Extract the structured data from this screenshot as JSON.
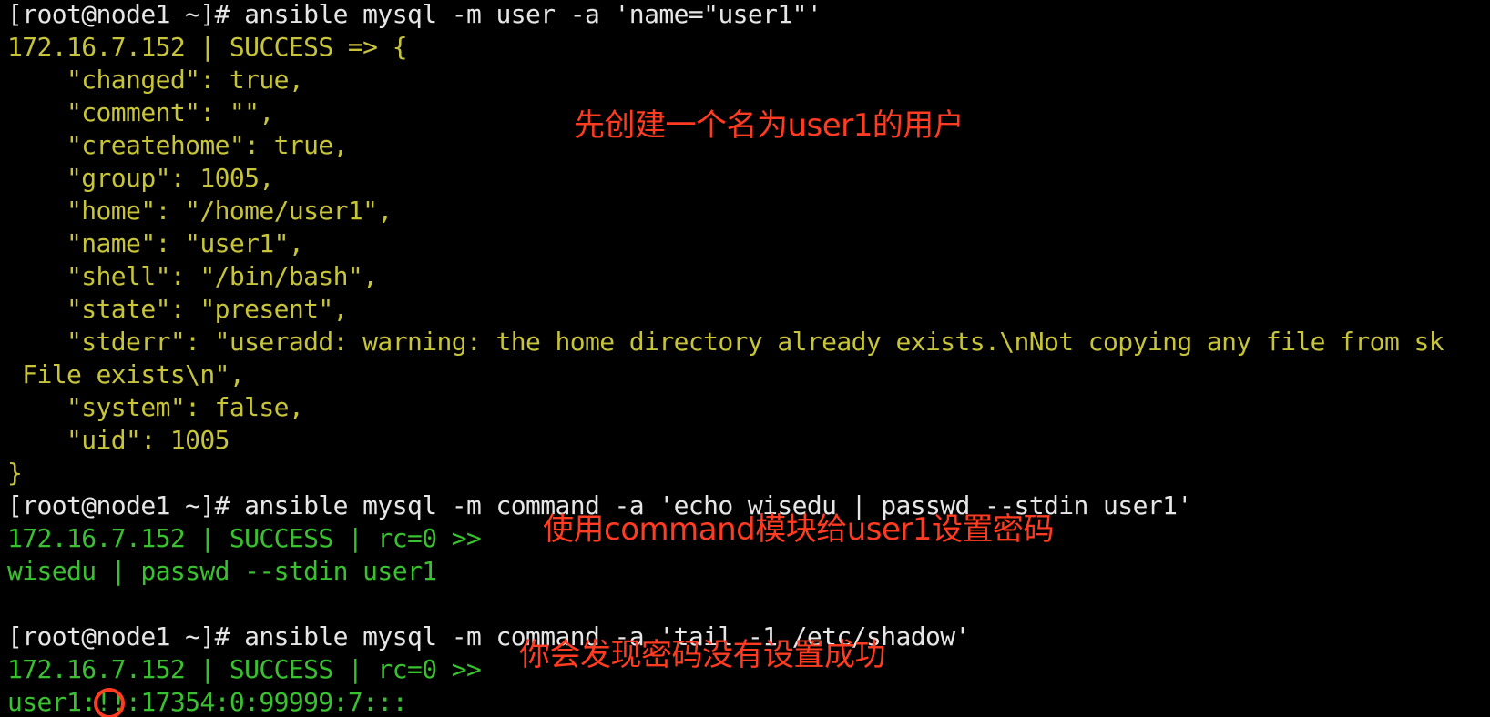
{
  "terminal": {
    "lines": [
      {
        "text": "[root@node1 ~]# ansible mysql -m user -a 'name=\"user1\"'",
        "color": "white"
      },
      {
        "text": "172.16.7.152 | SUCCESS => {",
        "color": "olive"
      },
      {
        "text": "    \"changed\": true,",
        "color": "olive"
      },
      {
        "text": "    \"comment\": \"\",",
        "color": "olive"
      },
      {
        "text": "    \"createhome\": true,",
        "color": "olive"
      },
      {
        "text": "    \"group\": 1005,",
        "color": "olive"
      },
      {
        "text": "    \"home\": \"/home/user1\",",
        "color": "olive"
      },
      {
        "text": "    \"name\": \"user1\",",
        "color": "olive"
      },
      {
        "text": "    \"shell\": \"/bin/bash\",",
        "color": "olive"
      },
      {
        "text": "    \"state\": \"present\",",
        "color": "olive"
      },
      {
        "text": "    \"stderr\": \"useradd: warning: the home directory already exists.\\nNot copying any file from sk",
        "color": "olive"
      },
      {
        "text": " File exists\\n\",",
        "color": "olive"
      },
      {
        "text": "    \"system\": false,",
        "color": "olive"
      },
      {
        "text": "    \"uid\": 1005",
        "color": "olive"
      },
      {
        "text": "}",
        "color": "olive"
      },
      {
        "text": "[root@node1 ~]# ansible mysql -m command -a 'echo wisedu | passwd --stdin user1'",
        "color": "white"
      },
      {
        "text": "172.16.7.152 | SUCCESS | rc=0 >>",
        "color": "green"
      },
      {
        "text": "wisedu | passwd --stdin user1",
        "color": "green"
      },
      {
        "text": "",
        "color": "green"
      },
      {
        "text": "[root@node1 ~]# ansible mysql -m command -a 'tail -1 /etc/shadow'",
        "color": "white"
      },
      {
        "text": "172.16.7.152 | SUCCESS | rc=0 >>",
        "color": "green"
      },
      {
        "text": "user1:!!:17354:0:99999:7:::",
        "color": "green"
      }
    ]
  },
  "annotations": {
    "create_user": "先创建一个名为user1的用户",
    "set_password": "使用command模块给user1设置密码",
    "not_set": "你会发现密码没有设置成功"
  },
  "colors": {
    "background": "#000000",
    "prompt": "#e6e6e6",
    "json_output": "#c7c43a",
    "command_output": "#39c12f",
    "annotation": "#ff3b21"
  }
}
